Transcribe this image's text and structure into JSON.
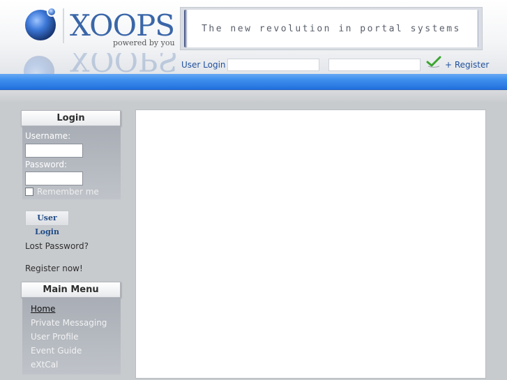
{
  "header": {
    "logo_text": "XOOPS",
    "logo_tagline": "powered by you",
    "banner_text": "The new revolution in portal systems"
  },
  "top_login": {
    "label": "User Login",
    "register_link": "+ Register",
    "username_value": "",
    "password_value": ""
  },
  "sidebar": {
    "login_block": {
      "title": "Login",
      "username_label": "Username:",
      "password_label": "Password:",
      "username_value": "",
      "password_value": "",
      "remember_label": "Remember me",
      "remember_checked": false,
      "submit_label": "User Login",
      "lost_password": "Lost Password?",
      "register_now": "Register now!"
    },
    "main_menu": {
      "title": "Main Menu",
      "items": [
        {
          "label": "Home",
          "active": true
        },
        {
          "label": "Private Messaging",
          "active": false
        },
        {
          "label": "User Profile",
          "active": false
        },
        {
          "label": "Event Guide",
          "active": false
        },
        {
          "label": "eXtCal",
          "active": false
        }
      ]
    }
  },
  "colors": {
    "nav_bar": "#3f8fee",
    "link": "#1f4f9c",
    "page_bg": "#c8cbce"
  }
}
